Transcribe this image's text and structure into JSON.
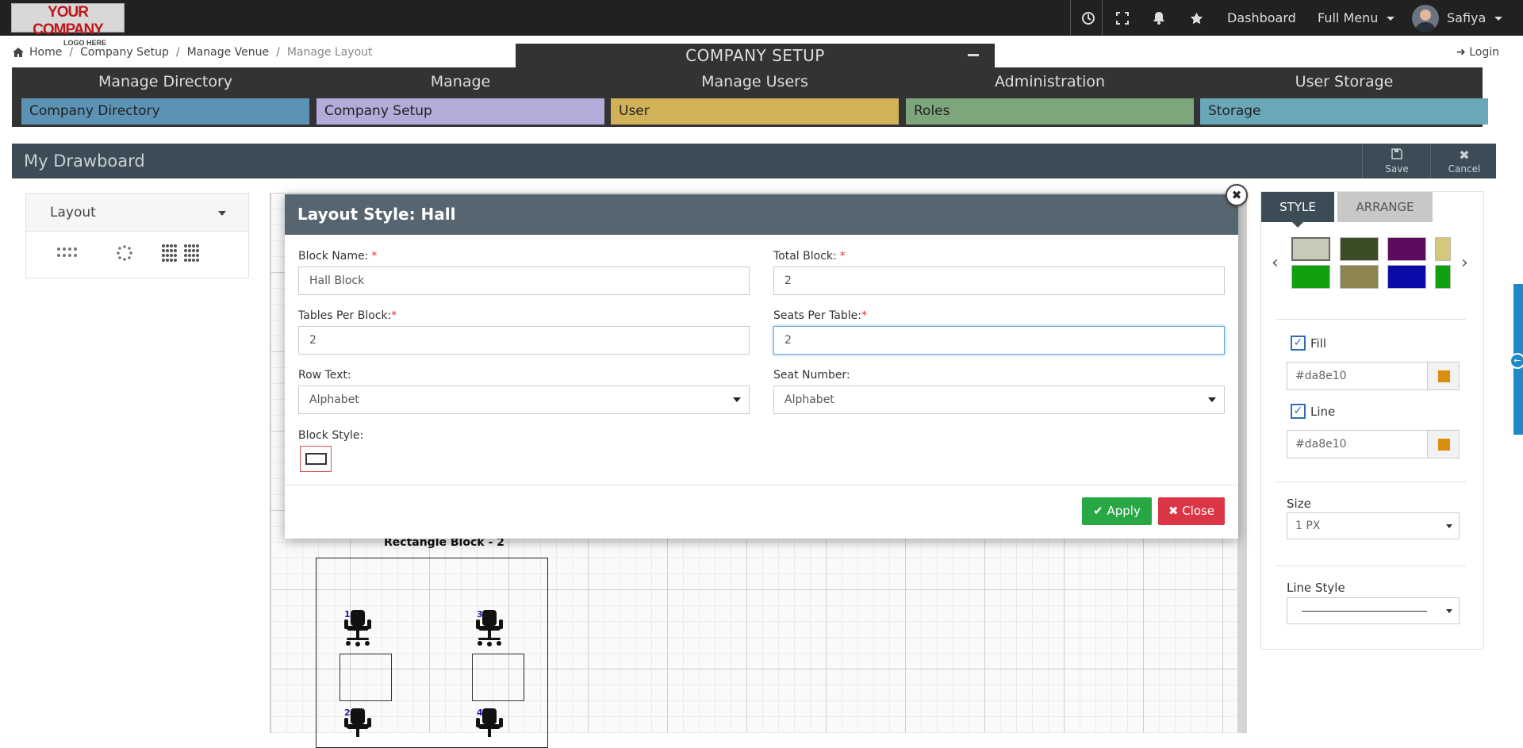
{
  "logo": {
    "line1": "YOUR COMPANY",
    "line2": "LOGO HERE"
  },
  "topbar": {
    "dashboard": "Dashboard",
    "full_menu": "Full Menu",
    "user_name": "Safiya"
  },
  "breadcrumb": [
    "Home",
    "Company Setup",
    "Manage Venue",
    "Manage Layout"
  ],
  "login": "Login",
  "company_setup_title": "COMPANY SETUP",
  "menu": [
    {
      "head": "Manage Directory",
      "item": "Company Directory",
      "color": "#5c93b5"
    },
    {
      "head": "Manage",
      "item": "Company Setup",
      "color": "#b3abd9"
    },
    {
      "head": "Manage Users",
      "item": "User",
      "color": "#d1b259"
    },
    {
      "head": "Administration",
      "item": "Roles",
      "color": "#7da67c"
    },
    {
      "head": "User Storage",
      "item": "Storage",
      "color": "#69a7b9"
    }
  ],
  "drawboard": {
    "title": "My Drawboard",
    "save": "Save",
    "cancel": "Cancel"
  },
  "layout_select": "Layout",
  "canvas": {
    "block_label": "Rectangle Block - 2",
    "seat_numbers": [
      "1",
      "2",
      "3",
      "4"
    ]
  },
  "style_panel": {
    "tab_style": "STYLE",
    "tab_arrange": "ARRANGE",
    "swatches_row1": [
      "#c9c9b9",
      "#3a4d27",
      "#5e0a5e",
      "#d4c87c"
    ],
    "swatches_row2": [
      "#10a010",
      "#8c8550",
      "#0a0aa6",
      "#10a010"
    ],
    "fill_label": "Fill",
    "fill_color": "#da8e10",
    "line_label": "Line",
    "line_color": "#da8e10",
    "size_label": "Size",
    "size_value": "1 PX",
    "line_style_label": "Line Style"
  },
  "modal": {
    "title": "Layout Style: Hall",
    "block_name_label": "Block Name:",
    "block_name_value": "Hall Block",
    "total_block_label": "Total Block:",
    "total_block_value": "2",
    "tables_per_block_label": "Tables Per Block:",
    "tables_per_block_value": "2",
    "seats_per_table_label": "Seats Per Table:",
    "seats_per_table_value": "2",
    "row_text_label": "Row Text:",
    "row_text_value": "Alphabet",
    "seat_number_label": "Seat Number:",
    "seat_number_value": "Alphabet",
    "block_style_label": "Block Style:",
    "required_mark": "*",
    "apply": "Apply",
    "close": "Close"
  }
}
